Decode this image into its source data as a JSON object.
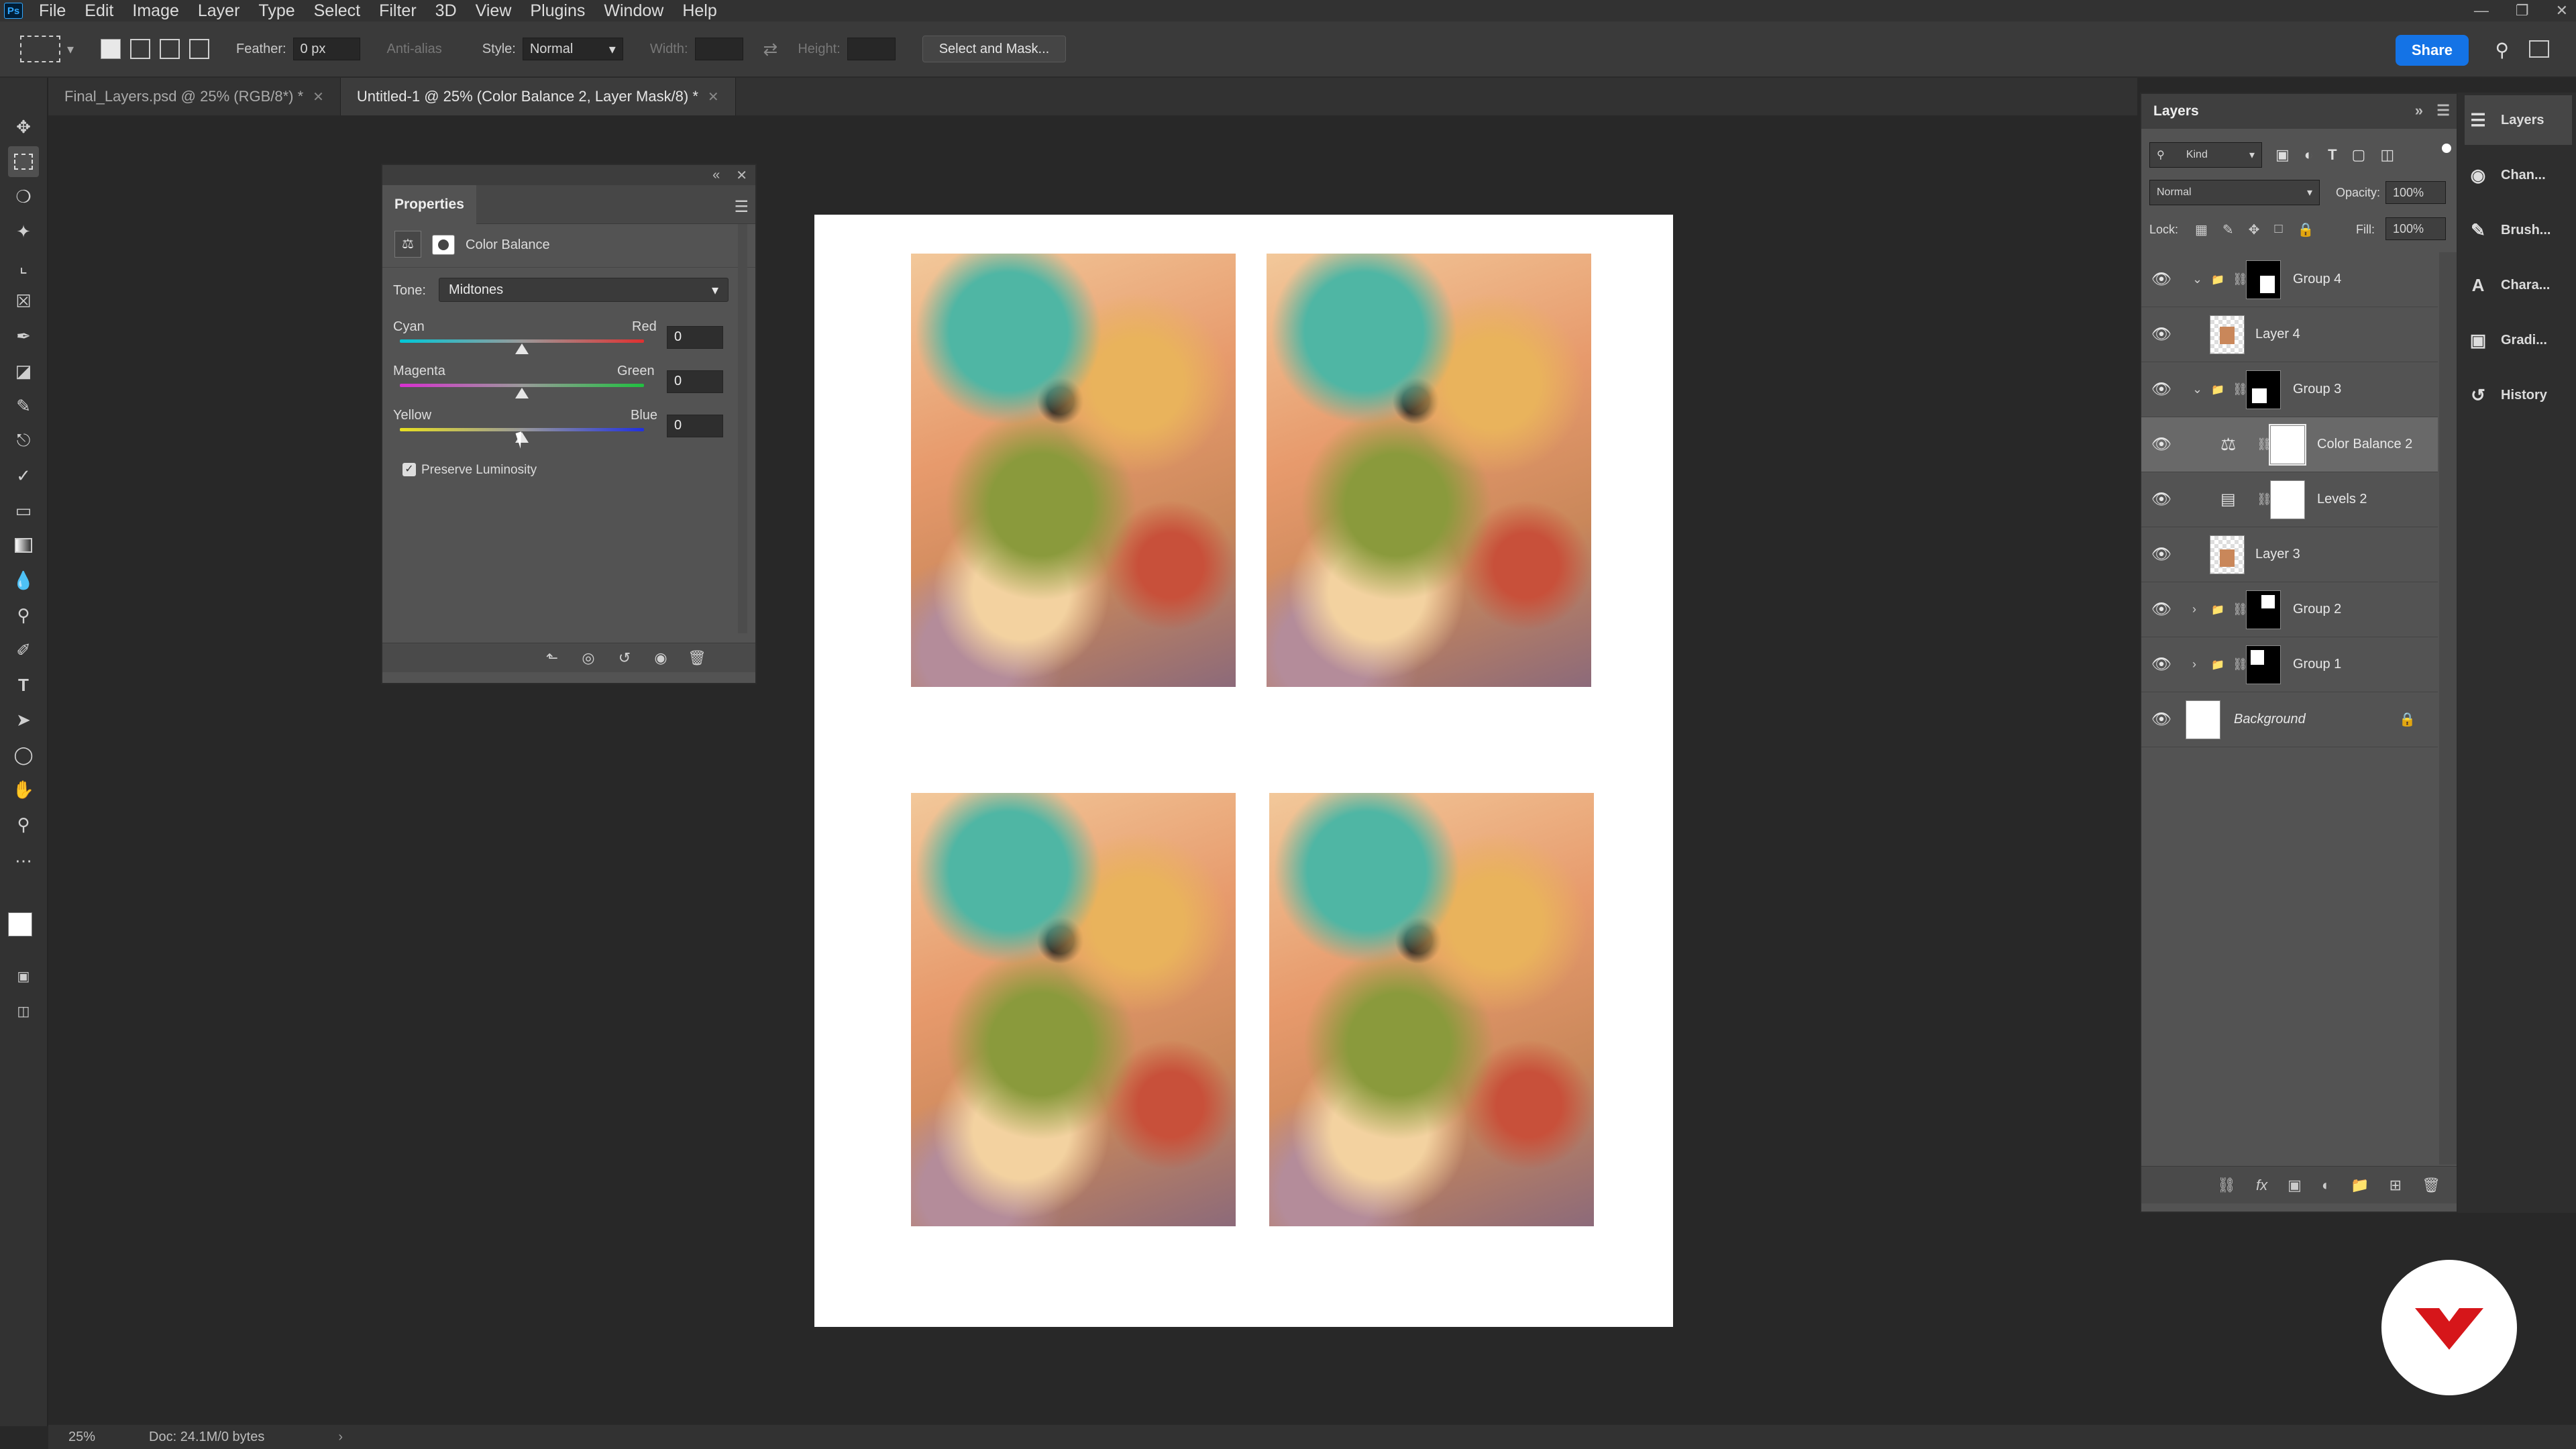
{
  "menubar": {
    "app": "Ps",
    "items": [
      "File",
      "Edit",
      "Image",
      "Layer",
      "Type",
      "Select",
      "Filter",
      "3D",
      "View",
      "Plugins",
      "Window",
      "Help"
    ]
  },
  "options": {
    "feather_label": "Feather:",
    "feather_value": "0 px",
    "antialias_label": "Anti-alias",
    "style_label": "Style:",
    "style_value": "Normal",
    "width_label": "Width:",
    "height_label": "Height:",
    "select_mask": "Select and Mask...",
    "share": "Share"
  },
  "tabs": [
    {
      "label": "Final_Layers.psd @ 25% (RGB/8*) *",
      "active": false
    },
    {
      "label": "Untitled-1 @ 25% (Color Balance 2, Layer Mask/8) *",
      "active": true
    }
  ],
  "properties": {
    "title": "Properties",
    "adjustment": "Color Balance",
    "tone_label": "Tone:",
    "tone_value": "Midtones",
    "sliders": [
      {
        "left": "Cyan",
        "right": "Red",
        "value": "0"
      },
      {
        "left": "Magenta",
        "right": "Green",
        "value": "0"
      },
      {
        "left": "Yellow",
        "right": "Blue",
        "value": "0"
      }
    ],
    "preserve": "Preserve Luminosity",
    "preserve_checked": true
  },
  "layers": {
    "title": "Layers",
    "kind": "Kind",
    "blend": "Normal",
    "opacity_label": "Opacity:",
    "opacity": "100%",
    "lock_label": "Lock:",
    "fill_label": "Fill:",
    "fill": "100%",
    "rows": [
      {
        "name": "Group 4"
      },
      {
        "name": "Layer 4"
      },
      {
        "name": "Group 3"
      },
      {
        "name": "Color Balance 2"
      },
      {
        "name": "Levels 2"
      },
      {
        "name": "Layer 3"
      },
      {
        "name": "Group 2"
      },
      {
        "name": "Group 1"
      },
      {
        "name": "Background"
      }
    ]
  },
  "dock": [
    "Layers",
    "Chan...",
    "Brush...",
    "Chara...",
    "Gradi...",
    "History"
  ],
  "status": {
    "zoom": "25%",
    "doc": "Doc: 24.1M/0 bytes"
  },
  "colors": {
    "accent": "#1473e6",
    "brand": "#d6161a"
  }
}
